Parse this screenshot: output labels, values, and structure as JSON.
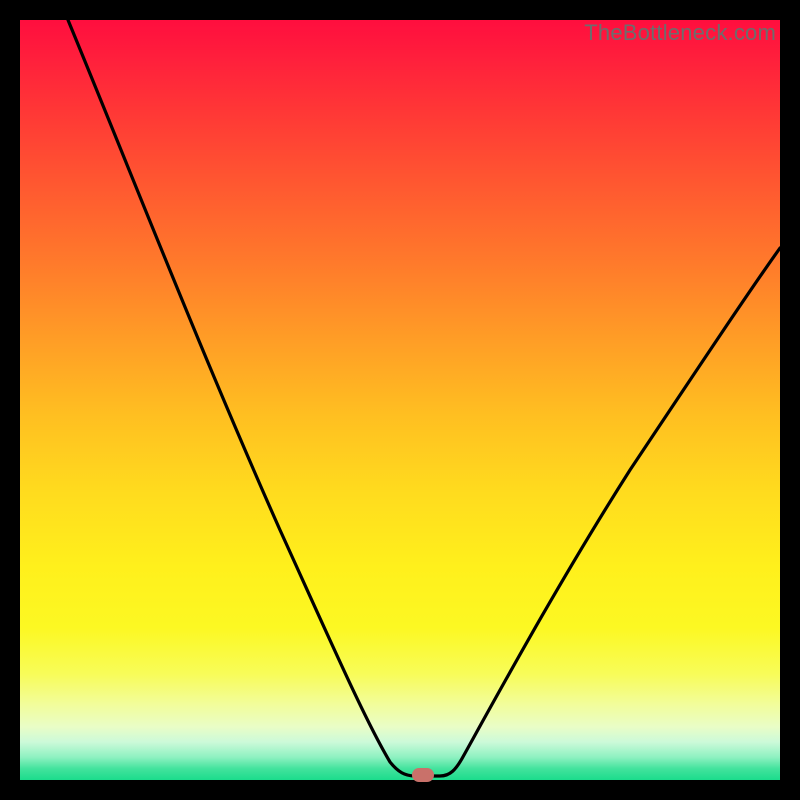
{
  "attribution": "TheBottleneck.com",
  "colors": {
    "page_bg": "#000000",
    "gradient_top": "#ff0e3e",
    "gradient_bottom": "#1bdc8c",
    "curve_stroke": "#000000",
    "marker_fill": "#c9716a"
  },
  "chart_data": {
    "type": "line",
    "title": "",
    "xlabel": "",
    "ylabel": "",
    "xlim": [
      0,
      100
    ],
    "ylim": [
      0,
      100
    ],
    "series": [
      {
        "name": "bottleneck-curve",
        "x": [
          0,
          6,
          12,
          18,
          24,
          30,
          36,
          42,
          46,
          49,
          50,
          53,
          56,
          60,
          66,
          72,
          78,
          84,
          90,
          96,
          100
        ],
        "values": [
          100,
          88,
          76,
          65,
          54,
          43,
          32,
          21,
          12,
          4,
          1,
          1,
          1,
          4,
          11,
          19,
          28,
          36,
          44,
          51,
          55
        ]
      }
    ],
    "marker": {
      "x": 52,
      "y": 0.5
    },
    "background": "rainbow-gradient-vertical"
  }
}
